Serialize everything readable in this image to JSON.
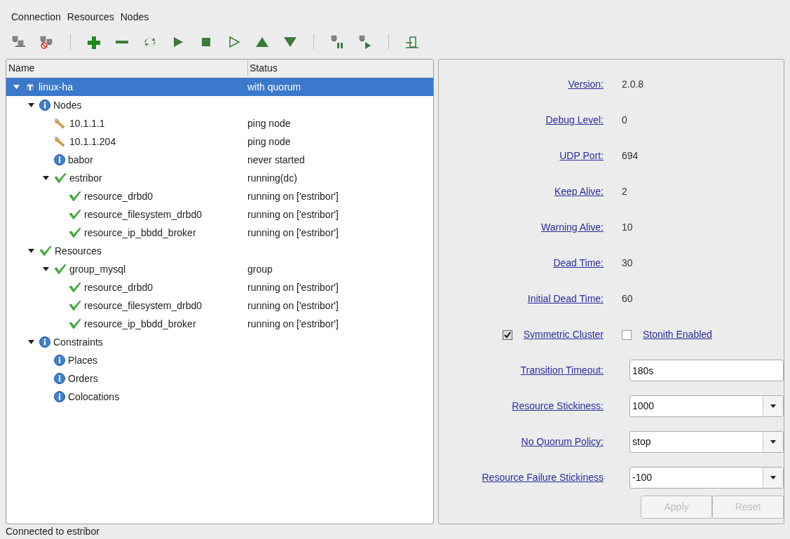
{
  "menu": [
    "Connection",
    "Resources",
    "Nodes"
  ],
  "tree": {
    "columns": [
      "Name",
      "Status"
    ],
    "items": [
      {
        "kind": "cluster",
        "name": "linux-ha",
        "status": "with quorum",
        "selected": true,
        "expanded": true,
        "children": [
          {
            "kind": "info",
            "name": "Nodes",
            "selected": false,
            "expanded": true,
            "children": [
              {
                "kind": "wrench",
                "name": "10.1.1.1",
                "status": "ping node",
                "selected": false
              },
              {
                "kind": "wrench",
                "name": "10.1.1.204",
                "status": "ping node",
                "selected": false
              },
              {
                "kind": "info",
                "name": "babor",
                "status": "never started",
                "selected": false
              },
              {
                "kind": "check",
                "name": "estribor",
                "status": "running(dc)",
                "selected": false,
                "expanded": true,
                "children": [
                  {
                    "kind": "check",
                    "name": "resource_drbd0",
                    "status": "running on ['estribor']",
                    "selected": false
                  },
                  {
                    "kind": "check",
                    "name": "resource_filesystem_drbd0",
                    "status": "running on ['estribor']",
                    "selected": false
                  },
                  {
                    "kind": "check",
                    "name": "resource_ip_bbdd_broker",
                    "status": "running on ['estribor']",
                    "selected": false
                  }
                ]
              }
            ]
          },
          {
            "kind": "check",
            "name": "Resources",
            "selected": false,
            "expanded": true,
            "children": [
              {
                "kind": "check",
                "name": "group_mysql",
                "status": "group",
                "selected": false,
                "expanded": true,
                "children": [
                  {
                    "kind": "check",
                    "name": "resource_drbd0",
                    "status": "running on ['estribor']",
                    "selected": false
                  },
                  {
                    "kind": "check",
                    "name": "resource_filesystem_drbd0",
                    "status": "running on ['estribor']",
                    "selected": false
                  },
                  {
                    "kind": "check",
                    "name": "resource_ip_bbdd_broker",
                    "status": "running on ['estribor']",
                    "selected": false
                  }
                ]
              }
            ]
          },
          {
            "kind": "info",
            "name": "Constraints",
            "selected": false,
            "expanded": true,
            "children": [
              {
                "kind": "info",
                "name": "Places",
                "selected": false
              },
              {
                "kind": "info",
                "name": "Orders",
                "selected": false
              },
              {
                "kind": "info",
                "name": "Colocations",
                "selected": false
              }
            ]
          }
        ]
      }
    ]
  },
  "properties": [
    {
      "kind": "info",
      "label": "Version:",
      "value": "2.0.8"
    },
    {
      "kind": "info",
      "label": "Debug Level:",
      "value": "0"
    },
    {
      "kind": "info",
      "label": "UDP Port:",
      "value": "694"
    },
    {
      "kind": "info",
      "label": "Keep Alive:",
      "value": "2"
    },
    {
      "kind": "info",
      "label": "Warning Alive:",
      "value": "10"
    },
    {
      "kind": "info",
      "label": "Dead Time:",
      "value": "30"
    },
    {
      "kind": "info",
      "label": "Initial Dead Time:",
      "value": "60"
    },
    {
      "kind": "checks",
      "checks": [
        {
          "label": "Symmetric Cluster",
          "checked": true
        },
        {
          "label": "Stonith Enabled",
          "checked": false
        }
      ]
    },
    {
      "kind": "text",
      "label": "Transition Timeout:",
      "value": "180s"
    },
    {
      "kind": "select",
      "label": "Resource Stickiness:",
      "value": "1000"
    },
    {
      "kind": "select",
      "label": "No Quorum Policy:",
      "value": "stop"
    },
    {
      "kind": "select",
      "label": "Resource Failure Stickiness",
      "value": "-100"
    }
  ],
  "buttons": [
    {
      "label": "Apply",
      "disabled": true
    },
    {
      "label": "Reset",
      "disabled": true
    }
  ],
  "status_bar": "Connected to estribor"
}
